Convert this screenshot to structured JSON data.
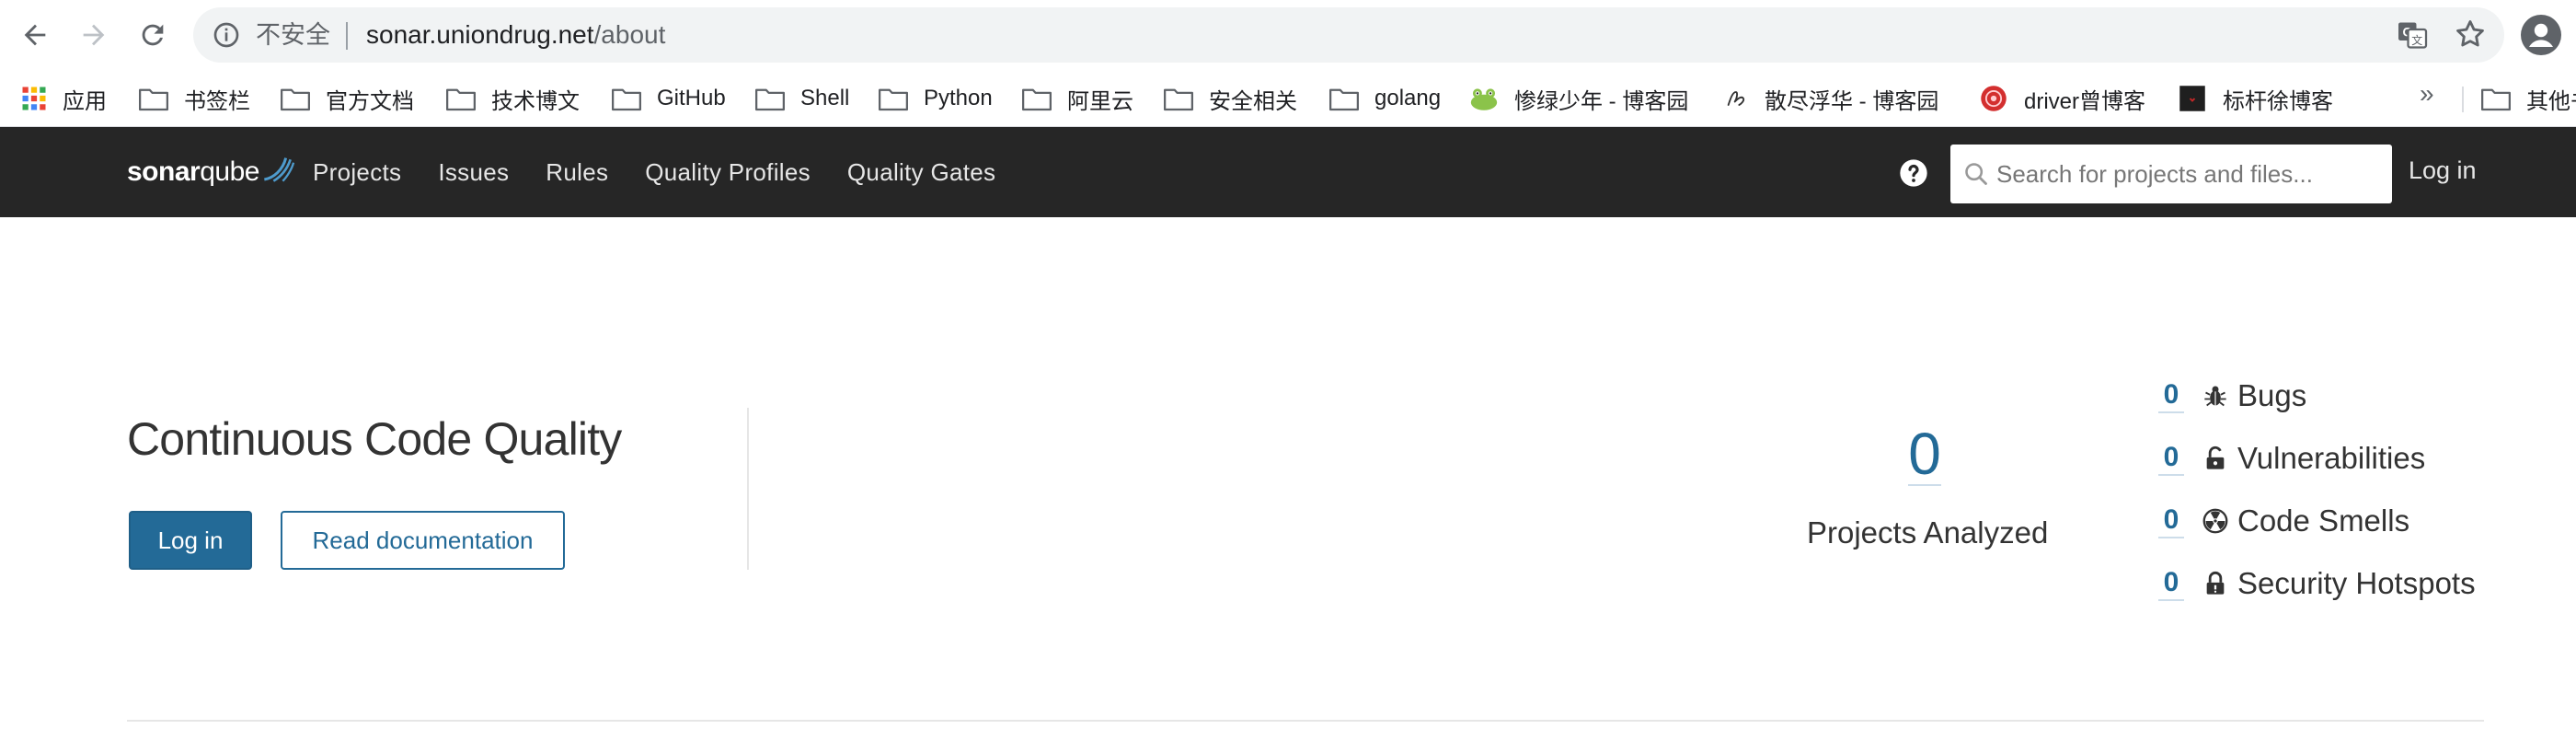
{
  "browser": {
    "security_label": "不安全",
    "url_host": "sonar.uniondrug.net",
    "url_path": "/about",
    "bookmarks": [
      {
        "label": "应用",
        "icon": "apps-grid-icon"
      },
      {
        "label": "书签栏",
        "icon": "folder-icon"
      },
      {
        "label": "官方文档",
        "icon": "folder-icon"
      },
      {
        "label": "技术博文",
        "icon": "folder-icon"
      },
      {
        "label": "GitHub",
        "icon": "folder-icon"
      },
      {
        "label": "Shell",
        "icon": "folder-icon"
      },
      {
        "label": "Python",
        "icon": "folder-icon"
      },
      {
        "label": "阿里云",
        "icon": "folder-icon"
      },
      {
        "label": "安全相关",
        "icon": "folder-icon"
      },
      {
        "label": "golang",
        "icon": "folder-icon"
      },
      {
        "label": "惨绿少年 - 博客园",
        "icon": "frog-favicon"
      },
      {
        "label": "散尽浮华 - 博客园",
        "icon": "script-favicon"
      },
      {
        "label": "driver曾博客",
        "icon": "red-seal-favicon"
      },
      {
        "label": "标杆徐博客",
        "icon": "dark-square-favicon"
      }
    ],
    "bookmarks_overflow": "»",
    "other_bookmarks_label": "其他书签"
  },
  "sonar_nav": {
    "logo_light": "sonar",
    "logo_bold": "qube",
    "menu": [
      "Projects",
      "Issues",
      "Rules",
      "Quality Profiles",
      "Quality Gates"
    ],
    "search_placeholder": "Search for projects and files...",
    "login_label": "Log in"
  },
  "hero": {
    "title": "Continuous Code Quality",
    "login_button": "Log in",
    "docs_button": "Read documentation"
  },
  "stats": {
    "projects_count": "0",
    "projects_label": "Projects Analyzed",
    "metrics": [
      {
        "value": "0",
        "label": "Bugs",
        "icon": "bug-icon"
      },
      {
        "value": "0",
        "label": "Vulnerabilities",
        "icon": "lock-icon"
      },
      {
        "value": "0",
        "label": "Code Smells",
        "icon": "radiation-icon"
      },
      {
        "value": "0",
        "label": "Security Hotspots",
        "icon": "shield-lock-icon"
      }
    ]
  },
  "colors": {
    "nav_bg": "#262626",
    "accent": "#236a97"
  }
}
